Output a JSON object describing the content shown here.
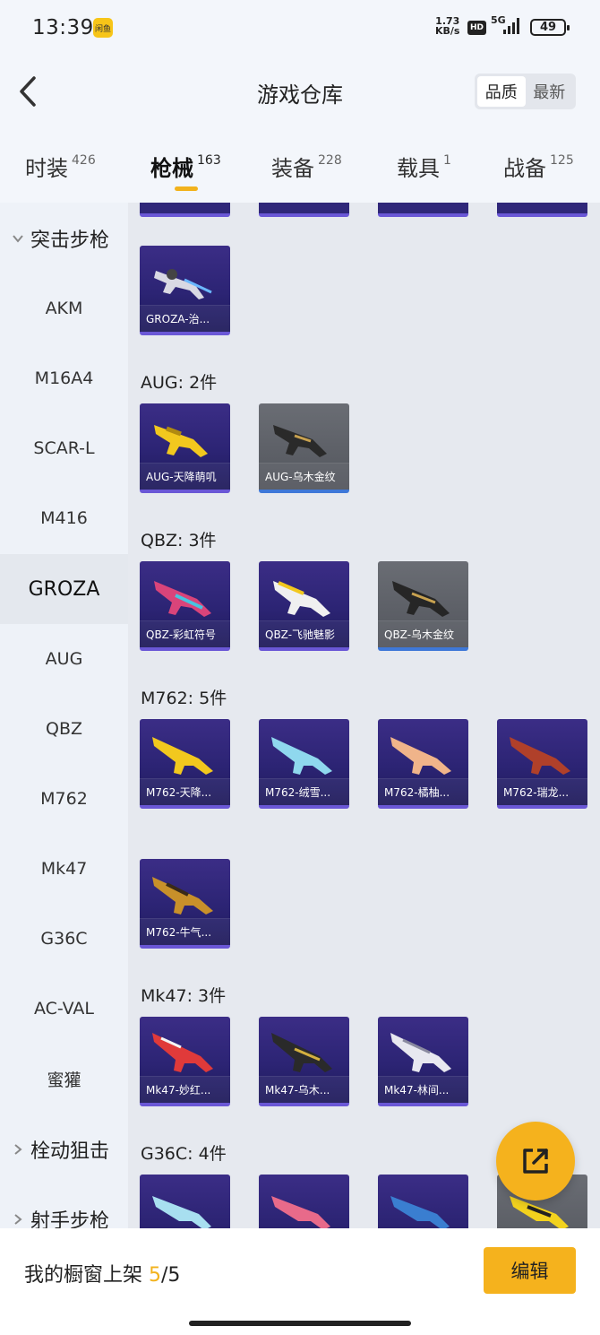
{
  "status_bar": {
    "time": "13:39",
    "app_icon_text": "闲鱼",
    "net_speed_value": "1.73",
    "net_speed_unit": "KB/s",
    "hd_label": "HD",
    "signal_label": "5G",
    "battery": "49"
  },
  "header": {
    "title": "游戏仓库",
    "sort_options": [
      "品质",
      "最新"
    ],
    "active_sort": "品质"
  },
  "tabs": [
    {
      "label": "时装",
      "count": "426"
    },
    {
      "label": "枪械",
      "count": "163"
    },
    {
      "label": "装备",
      "count": "228"
    },
    {
      "label": "载具",
      "count": "1"
    },
    {
      "label": "战备",
      "count": "125"
    }
  ],
  "active_tab": "枪械",
  "sidebar": {
    "group_assault": "突击步枪",
    "items": [
      "AKM",
      "M16A4",
      "SCAR-L",
      "M416",
      "GROZA",
      "AUG",
      "QBZ",
      "M762",
      "Mk47",
      "G36C",
      "AC-VAL",
      "蜜獾"
    ],
    "active_item": "GROZA",
    "group_bolt": "栓动狙击",
    "group_marksman": "射手步枪"
  },
  "sections": {
    "aug": {
      "label": "AUG: 2件"
    },
    "qbz": {
      "label": "QBZ: 3件"
    },
    "m762": {
      "label": "M762: 5件"
    },
    "mk47": {
      "label": "Mk47: 3件"
    },
    "g36c": {
      "label": "G36C: 4件"
    }
  },
  "cards": {
    "groza_1": "GROZA-治...",
    "aug_1": "AUG-天降萌叽",
    "aug_2": "AUG-乌木金纹",
    "qbz_1": "QBZ-彩虹符号",
    "qbz_2": "QBZ-飞驰魅影",
    "qbz_3": "QBZ-乌木金纹",
    "m762_1": "M762-天降...",
    "m762_2": "M762-绒雪...",
    "m762_3": "M762-橘柚...",
    "m762_4": "M762-瑞龙...",
    "m762_5": "M762-牛气...",
    "mk47_1": "Mk47-妙红...",
    "mk47_2": "Mk47-乌木...",
    "mk47_3": "Mk47-林间..."
  },
  "footer": {
    "label": "我的橱窗上架",
    "current": "5",
    "slash_total": "/5",
    "edit_label": "编辑"
  },
  "colors": {
    "accent": "#f5b21d",
    "card_purple": "#2c2474",
    "card_gray": "#5a5d64",
    "rarity_purple": "#6a57d6",
    "rarity_blue": "#3e78d8"
  }
}
